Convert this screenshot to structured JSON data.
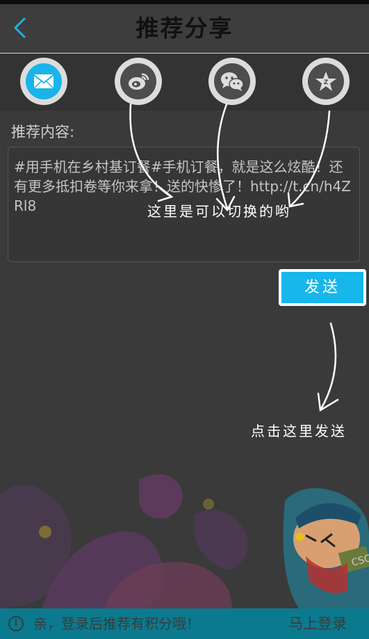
{
  "header": {
    "title": "推荐分享"
  },
  "share": {
    "options": [
      {
        "icon": "mail-icon"
      },
      {
        "icon": "weibo-icon"
      },
      {
        "icon": "wechat-icon"
      },
      {
        "icon": "qzone-star-icon"
      }
    ]
  },
  "content": {
    "label": "推荐内容:",
    "text": "#用手机在乡村基订餐#手机订餐，就是这么炫酷！还有更多抵扣卷等你来拿！送的快惨了！http://t.cn/h4ZRl8"
  },
  "send_button": {
    "label": "发送"
  },
  "annotations": {
    "switch_hint": "这里是可以切换的哟",
    "send_hint": "点击这里发送"
  },
  "bottom": {
    "notice": "亲，登录后推荐有积分哦！",
    "login_label": "马上登录"
  },
  "colors": {
    "accent": "#17b6eb",
    "bottom_bar": "#0b7a8e"
  }
}
